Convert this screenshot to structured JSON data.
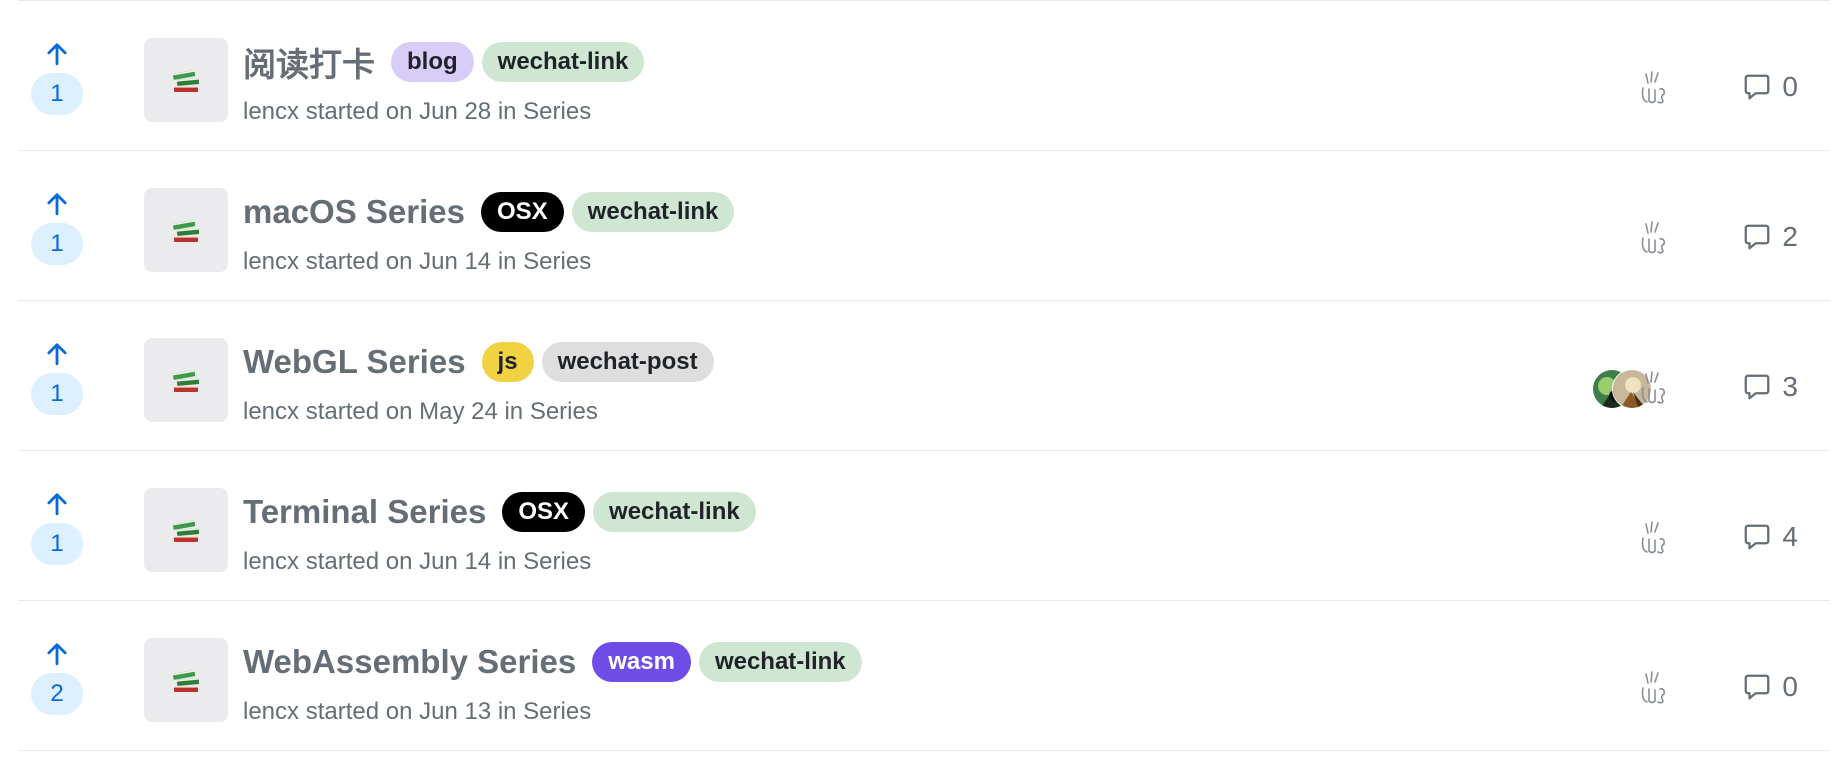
{
  "colors": {
    "vote_blue": "#0969da",
    "vote_bg": "#ddf0ff",
    "muted_text": "#656d76",
    "divider": "#e8eaed"
  },
  "discussions": [
    {
      "title": "阅读打卡",
      "votes": "1",
      "meta": "lencx started on Jun 28 in Series",
      "labels": [
        {
          "text": "blog",
          "bg": "#d8cdf6",
          "fg": "#1f2328"
        },
        {
          "text": "wechat-link",
          "bg": "#cfe6d3",
          "fg": "#1f2328"
        }
      ],
      "participants": [
        "sketch"
      ],
      "comments": "0"
    },
    {
      "title": "macOS Series",
      "votes": "1",
      "meta": "lencx started on Jun 14 in Series",
      "labels": [
        {
          "text": "OSX",
          "bg": "#000000",
          "fg": "#ffffff"
        },
        {
          "text": "wechat-link",
          "bg": "#cfe6d3",
          "fg": "#1f2328"
        }
      ],
      "participants": [
        "sketch"
      ],
      "comments": "2"
    },
    {
      "title": "WebGL Series",
      "votes": "1",
      "meta": "lencx started on May 24 in Series",
      "labels": [
        {
          "text": "js",
          "bg": "#f1d242",
          "fg": "#1f2328"
        },
        {
          "text": "wechat-post",
          "bg": "#dedede",
          "fg": "#1f2328"
        }
      ],
      "participants": [
        "photo-green",
        "photo-brown",
        "sketch"
      ],
      "comments": "3"
    },
    {
      "title": "Terminal Series",
      "votes": "1",
      "meta": "lencx started on Jun 14 in Series",
      "labels": [
        {
          "text": "OSX",
          "bg": "#000000",
          "fg": "#ffffff"
        },
        {
          "text": "wechat-link",
          "bg": "#cfe6d3",
          "fg": "#1f2328"
        }
      ],
      "participants": [
        "sketch"
      ],
      "comments": "4"
    },
    {
      "title": "WebAssembly Series",
      "votes": "2",
      "meta": "lencx started on Jun 13 in Series",
      "labels": [
        {
          "text": "wasm",
          "bg": "#6e4de6",
          "fg": "#ffffff"
        },
        {
          "text": "wechat-link",
          "bg": "#cfe6d3",
          "fg": "#1f2328"
        }
      ],
      "participants": [
        "sketch"
      ],
      "comments": "0"
    }
  ]
}
